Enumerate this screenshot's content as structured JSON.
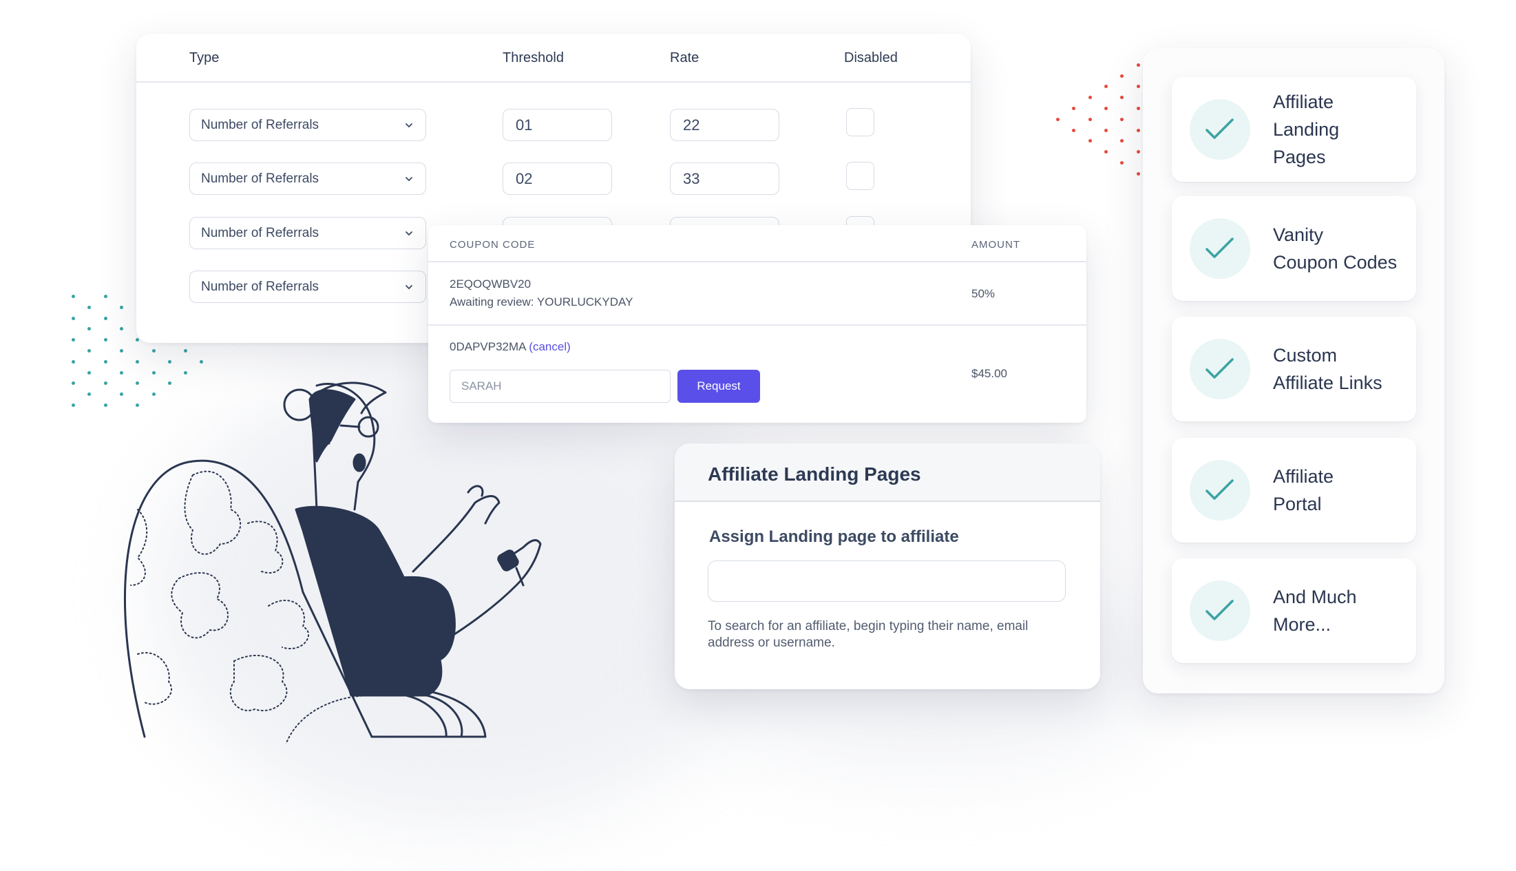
{
  "colors": {
    "accent_button": "#5a4fe8",
    "cancel_link": "#5a4fe0",
    "check_teal": "#3aa3a3",
    "check_circle": "#eaf5f5",
    "dots_red": "#e84a3c",
    "dots_teal": "#3aa3a3",
    "ink": "#2a3650"
  },
  "referral_table": {
    "headers": {
      "type": "Type",
      "threshold": "Threshold",
      "rate": "Rate",
      "disabled": "Disabled"
    },
    "rows": [
      {
        "type": "Number of Referrals",
        "threshold": "01",
        "rate": "22",
        "disabled": false
      },
      {
        "type": "Number of Referrals",
        "threshold": "02",
        "rate": "33",
        "disabled": false
      },
      {
        "type": "Number of Referrals",
        "threshold": "",
        "rate": "",
        "disabled": false
      },
      {
        "type": "Number of Referrals",
        "threshold": "",
        "rate": "",
        "disabled": false
      }
    ]
  },
  "coupons": {
    "headers": {
      "code": "COUPON CODE",
      "amount": "AMOUNT"
    },
    "rows": [
      {
        "code": "2EQOQWBV20",
        "note": "Awaiting review: YOURLUCKYDAY",
        "amount": "50%"
      },
      {
        "code": "0DAPVP32MA",
        "cancel_label": "(cancel)",
        "name_value": "SARAH",
        "request_label": "Request",
        "amount": "$45.00"
      }
    ]
  },
  "landing_pages": {
    "title": "Affiliate Landing Pages",
    "field_label": "Assign Landing page to affiliate",
    "field_value": "",
    "help_text": "To search for an affiliate, begin typing their name, email address or username."
  },
  "features": [
    {
      "label": "Affiliate\nLanding\nPages",
      "icon": "check-icon"
    },
    {
      "label": "Vanity\nCoupon Codes",
      "icon": "check-icon"
    },
    {
      "label": "Custom\nAffiliate Links",
      "icon": "check-icon"
    },
    {
      "label": "Affiliate\nPortal",
      "icon": "check-icon"
    },
    {
      "label": "And Much\nMore...",
      "icon": "check-icon"
    }
  ],
  "illustration": {
    "subject": "person-pointing-in-chair"
  }
}
